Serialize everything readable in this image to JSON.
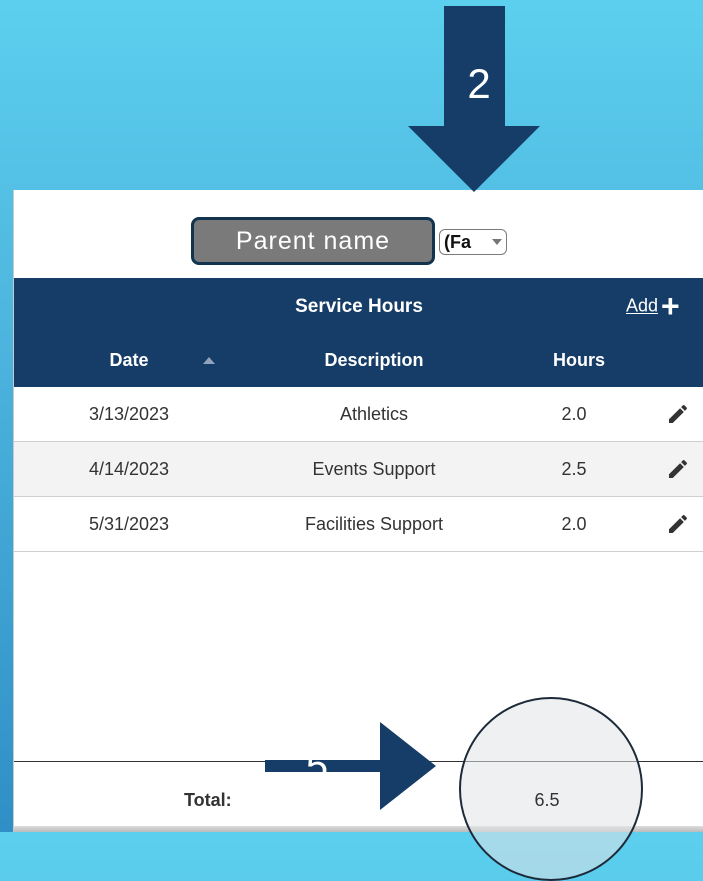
{
  "callouts": {
    "step_2": "2",
    "step_5": "5."
  },
  "parent_selector": {
    "name_placeholder": "Parent name",
    "family_select_value": "(Fa"
  },
  "table": {
    "title": "Service Hours",
    "add_label": "Add",
    "add_icon": "plus-icon",
    "columns": [
      "Date",
      "Description",
      "Hours"
    ],
    "sort": {
      "column": "Date",
      "direction": "ascending"
    },
    "rows": [
      {
        "date": "3/13/2023",
        "description": "Athletics",
        "hours": "2.0"
      },
      {
        "date": "4/14/2023",
        "description": "Events Support",
        "hours": "2.5"
      },
      {
        "date": "5/31/2023",
        "description": "Facilities Support",
        "hours": "2.0"
      }
    ],
    "total_label": "Total:",
    "total_value": "6.5"
  },
  "colors": {
    "header_bg": "#163d67",
    "callout_bg": "#163d67",
    "page_bg_top": "#5ccfee",
    "page_bg_bottom": "#2f8fc6"
  }
}
